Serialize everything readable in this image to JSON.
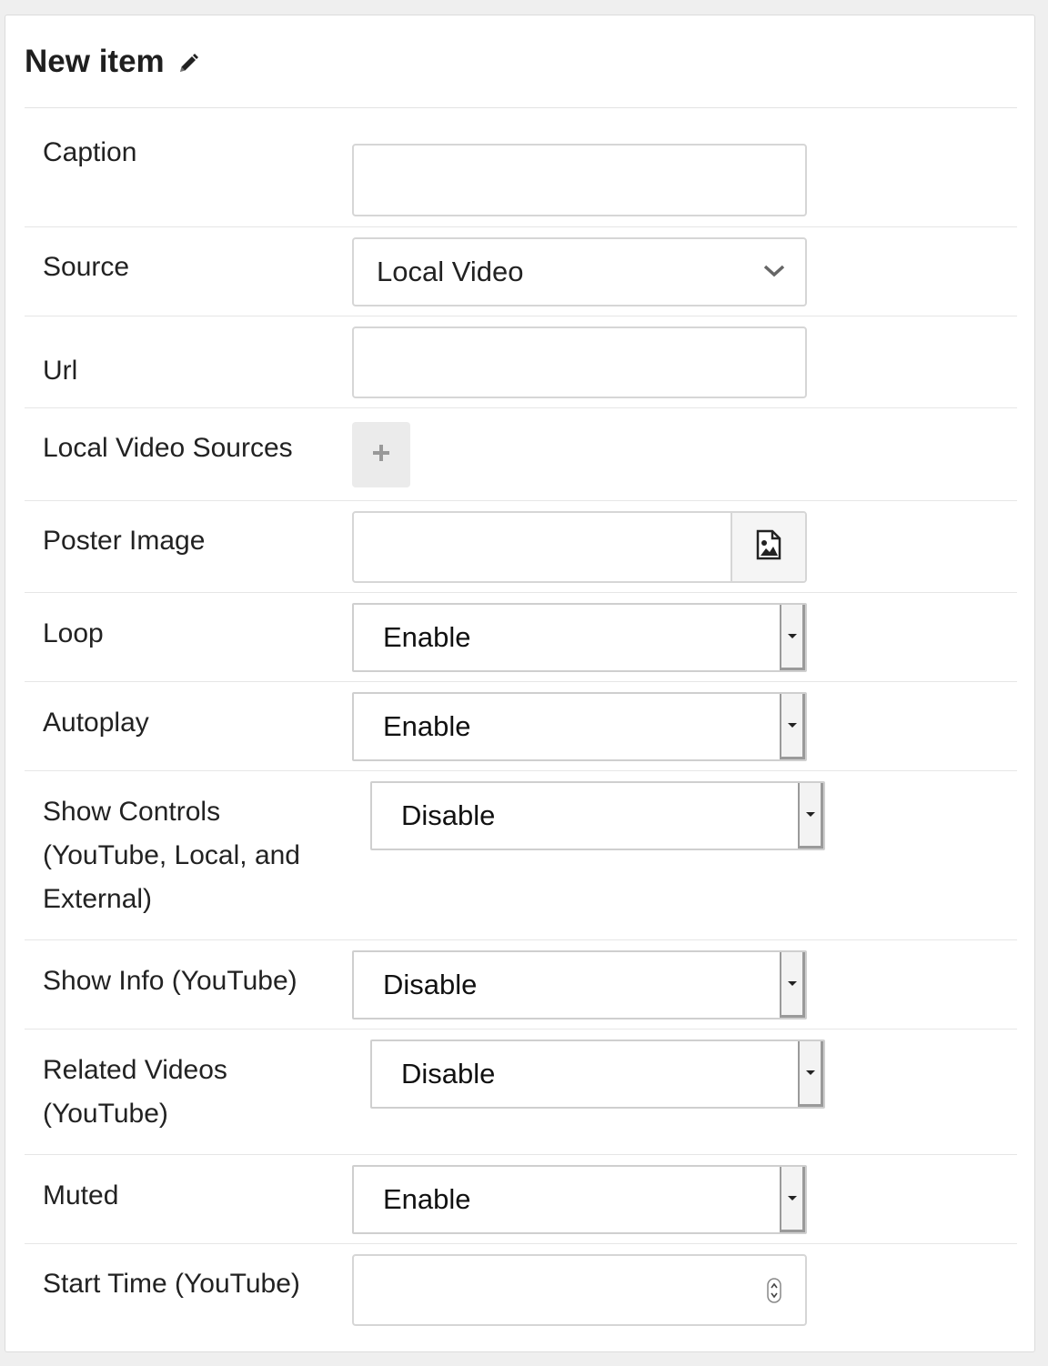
{
  "header": {
    "title": "New item"
  },
  "form": {
    "caption": {
      "label": "Caption",
      "value": ""
    },
    "source": {
      "label": "Source",
      "value": "Local Video"
    },
    "url": {
      "label": "Url",
      "value": ""
    },
    "local_sources": {
      "label": "Local Video Sources"
    },
    "poster": {
      "label": "Poster Image",
      "value": ""
    },
    "loop": {
      "label": "Loop",
      "value": "Enable"
    },
    "autoplay": {
      "label": "Autoplay",
      "value": "Enable"
    },
    "show_controls": {
      "label_line1": "Show Controls",
      "label_line2": "(YouTube, Local, and",
      "label_line3": "External)",
      "value": "Disable"
    },
    "show_info": {
      "label": "Show Info (YouTube)",
      "value": "Disable"
    },
    "related_videos": {
      "label_line1": "Related Videos",
      "label_line2": "(YouTube)",
      "value": "Disable"
    },
    "muted": {
      "label": "Muted",
      "value": "Enable"
    },
    "start_time": {
      "label": "Start Time (YouTube)",
      "value": ""
    }
  },
  "icons": {
    "edit": "pencil-icon",
    "source_dropdown": "chevron-down-icon",
    "add": "plus-icon",
    "poster_picker": "image-file-icon",
    "select_arrow": "caret-down-icon",
    "number_spinner": "spinner-arrows-icon"
  }
}
